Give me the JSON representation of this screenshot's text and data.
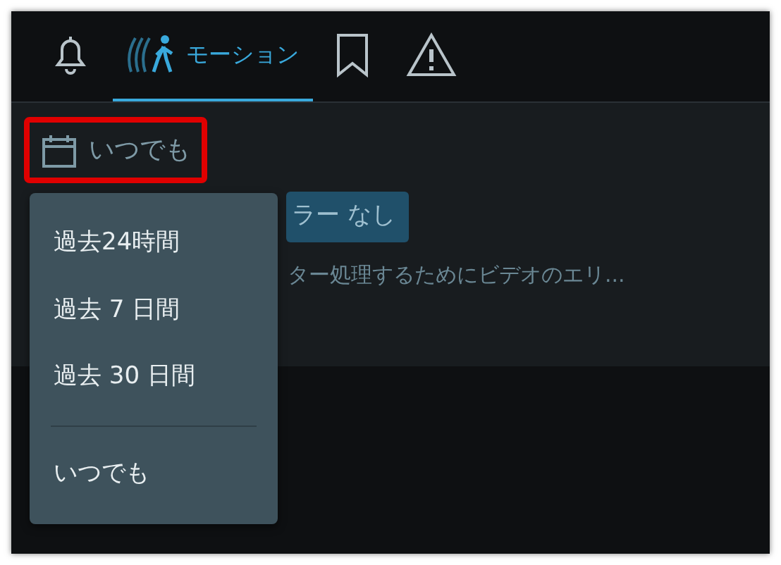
{
  "tabs": [
    {
      "kind": "bell",
      "selected": false
    },
    {
      "kind": "motion",
      "label": "モーション",
      "selected": true
    },
    {
      "kind": "bookmark",
      "selected": false
    },
    {
      "kind": "alert",
      "selected": false
    }
  ],
  "date_filter": {
    "label": "いつでも",
    "highlighted": true
  },
  "filter_chip": {
    "label": "ラー なし"
  },
  "description": "ター処理するためにビデオのエリ...",
  "date_menu": {
    "items": [
      {
        "kind": "option",
        "label": "過去24時間"
      },
      {
        "kind": "option",
        "label": "過去 7 日間"
      },
      {
        "kind": "option",
        "label": "過去 30 日間"
      },
      {
        "kind": "divider"
      },
      {
        "kind": "option",
        "label": "いつでも"
      }
    ]
  }
}
